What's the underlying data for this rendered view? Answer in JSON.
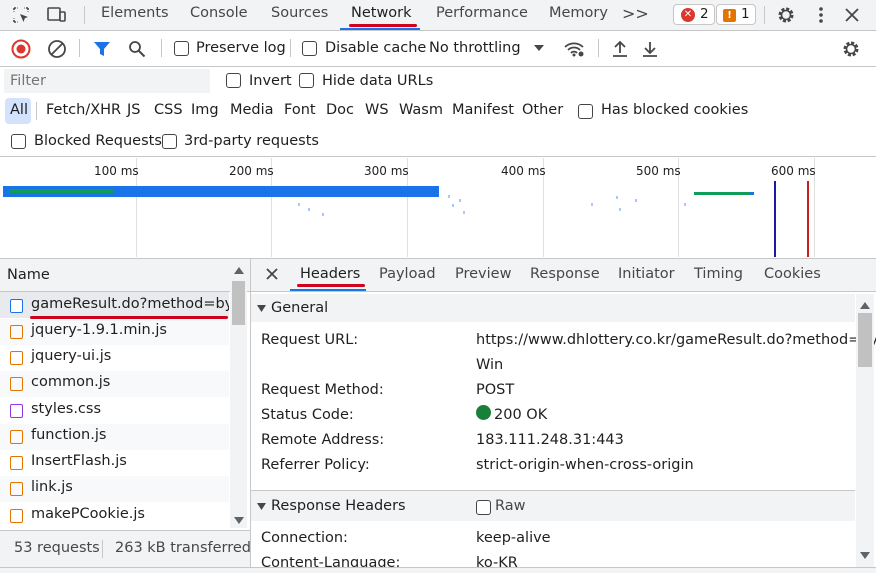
{
  "main_tabs": [
    "Elements",
    "Console",
    "Sources",
    "Network",
    "Performance",
    "Memory"
  ],
  "active_tab": "Network",
  "more_tabs_glyph": ">>",
  "badges": {
    "errors": "2",
    "warnings": "1"
  },
  "toolbar": {
    "preserve_log": "Preserve log",
    "disable_cache": "Disable cache",
    "throttling": "No throttling"
  },
  "filter": {
    "placeholder": "Filter",
    "invert": "Invert",
    "hide_data_urls": "Hide data URLs"
  },
  "type_filters": [
    "All",
    "Fetch/XHR",
    "JS",
    "CSS",
    "Img",
    "Media",
    "Font",
    "Doc",
    "WS",
    "Wasm",
    "Manifest",
    "Other"
  ],
  "has_blocked_cookies": "Has blocked cookies",
  "blocked_requests": "Blocked Requests",
  "third_party": "3rd-party requests",
  "timeline_ticks": [
    "100 ms",
    "200 ms",
    "300 ms",
    "400 ms",
    "500 ms",
    "600 ms"
  ],
  "request_list": {
    "header": "Name",
    "items": [
      {
        "name": "gameResult.do?method=by...",
        "type": "doc"
      },
      {
        "name": "jquery-1.9.1.min.js",
        "type": "js"
      },
      {
        "name": "jquery-ui.js",
        "type": "js"
      },
      {
        "name": "common.js",
        "type": "js"
      },
      {
        "name": "styles.css",
        "type": "css"
      },
      {
        "name": "function.js",
        "type": "js"
      },
      {
        "name": "InsertFlash.js",
        "type": "js"
      },
      {
        "name": "link.js",
        "type": "js"
      },
      {
        "name": "makePCookie.js",
        "type": "js"
      }
    ]
  },
  "status_bar": {
    "requests": "53 requests",
    "transferred": "263 kB transferred"
  },
  "detail_tabs": [
    "Headers",
    "Payload",
    "Preview",
    "Response",
    "Initiator",
    "Timing",
    "Cookies"
  ],
  "general": {
    "title": "General",
    "request_url_label": "Request URL:",
    "request_url_line1": "https://www.dhlottery.co.kr/gameResult.do?method=by",
    "request_url_line2": "Win",
    "method_label": "Request Method:",
    "method": "POST",
    "status_label": "Status Code:",
    "status": "200 OK",
    "remote_label": "Remote Address:",
    "remote": "183.111.248.31:443",
    "referrer_label": "Referrer Policy:",
    "referrer": "strict-origin-when-cross-origin"
  },
  "response_headers": {
    "title": "Response Headers",
    "raw": "Raw",
    "connection_label": "Connection:",
    "connection": "keep-alive",
    "content_language_label": "Content-Language:",
    "content_language": "ko-KR"
  },
  "colors": {
    "accent_blue": "#1a73e8",
    "annotation_red": "#d0021b",
    "record_red": "#dc362e",
    "status_green": "#188038"
  }
}
